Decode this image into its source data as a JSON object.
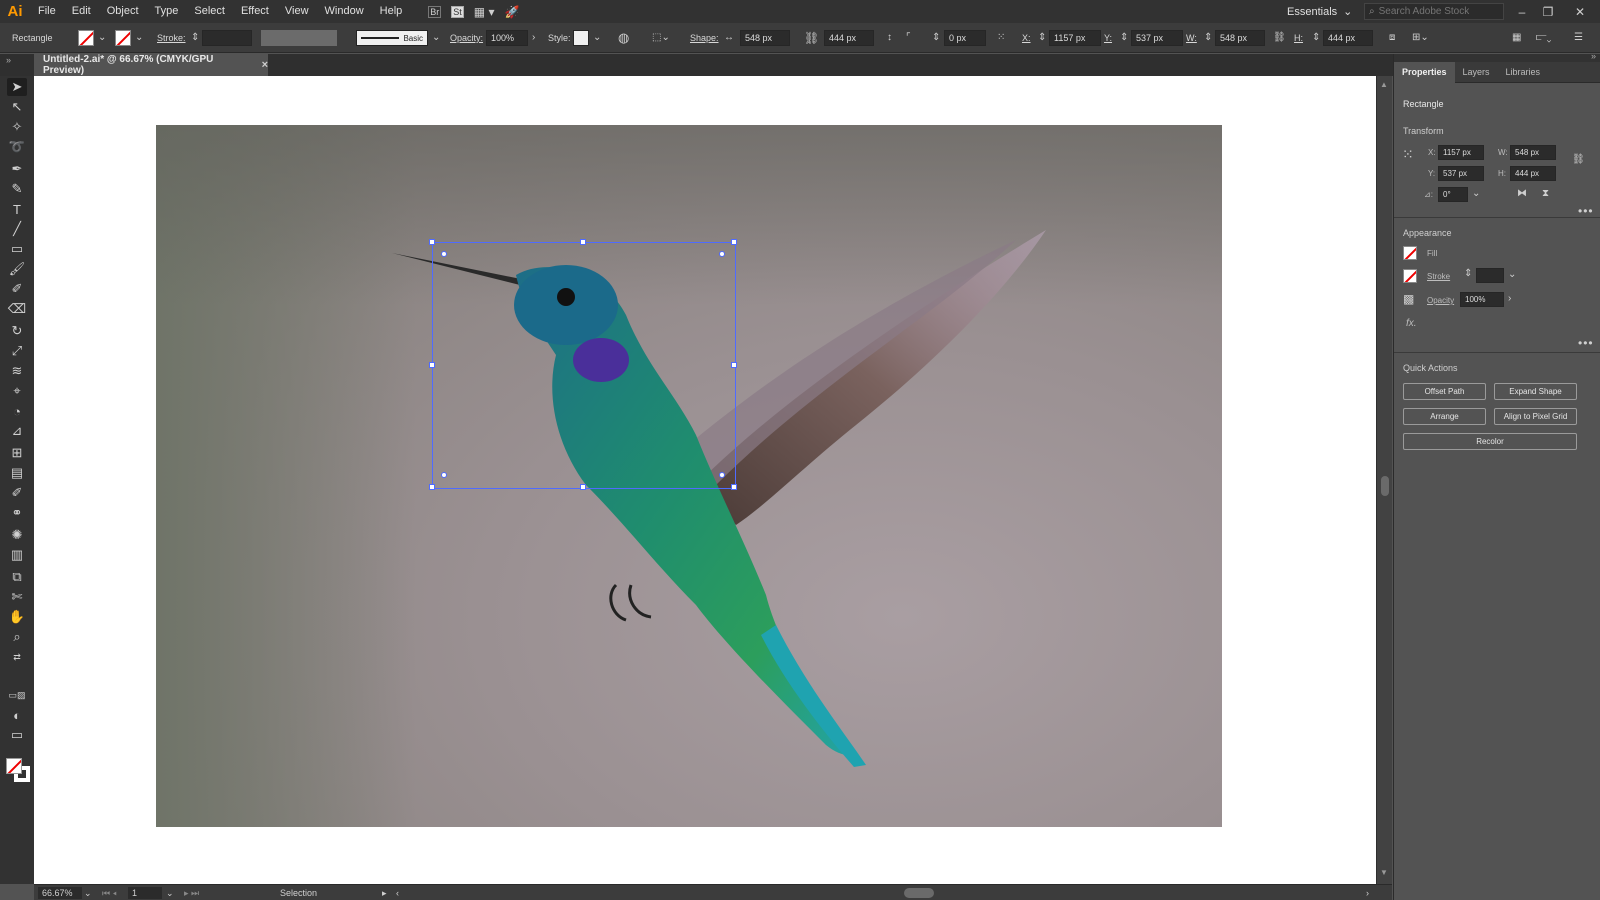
{
  "app": {
    "logo": "Ai"
  },
  "menu": [
    "File",
    "Edit",
    "Object",
    "Type",
    "Select",
    "Effect",
    "View",
    "Window",
    "Help"
  ],
  "menu_icons": {
    "bridge": "Br",
    "stock": "St"
  },
  "workspace": {
    "label": "Essentials"
  },
  "search": {
    "placeholder": "Search Adobe Stock"
  },
  "control": {
    "object_type": "Rectangle",
    "stroke_label": "Stroke:",
    "brush": "Basic",
    "opacity_label": "Opacity:",
    "opacity": "100%",
    "style_label": "Style:",
    "shape_label": "Shape:",
    "shape_w": "548 px",
    "shape_h": "444 px",
    "corner": "0 px",
    "x_label": "X:",
    "x": "1157 px",
    "y_label": "Y:",
    "y": "537 px",
    "w_label": "W:",
    "w": "548 px",
    "h_label": "H:",
    "h": "444 px"
  },
  "document": {
    "tab": "Untitled-2.ai* @ 66.67% (CMYK/GPU Preview)",
    "close": "×"
  },
  "status": {
    "zoom": "66.67%",
    "artboard": "1",
    "tool": "Selection"
  },
  "panel": {
    "tabs": [
      "Properties",
      "Layers",
      "Libraries"
    ],
    "object": "Rectangle",
    "transform": {
      "heading": "Transform",
      "x_label": "X:",
      "x": "1157 px",
      "y_label": "Y:",
      "y": "537 px",
      "w_label": "W:",
      "w": "548 px",
      "h_label": "H:",
      "h": "444 px",
      "angle_label": "⊿:",
      "angle": "0°"
    },
    "appearance": {
      "heading": "Appearance",
      "fill": "Fill",
      "stroke": "Stroke",
      "opacity_label": "Opacity",
      "opacity": "100%",
      "fx": "fx."
    },
    "quick_actions": {
      "heading": "Quick Actions",
      "offset_path": "Offset Path",
      "expand_shape": "Expand Shape",
      "arrange": "Arrange",
      "align_pixel": "Align to Pixel Grid",
      "recolor": "Recolor"
    }
  },
  "colors": {
    "accent": "#ff9a00",
    "selection": "#4f6bff",
    "no_fill": "#e00000"
  }
}
